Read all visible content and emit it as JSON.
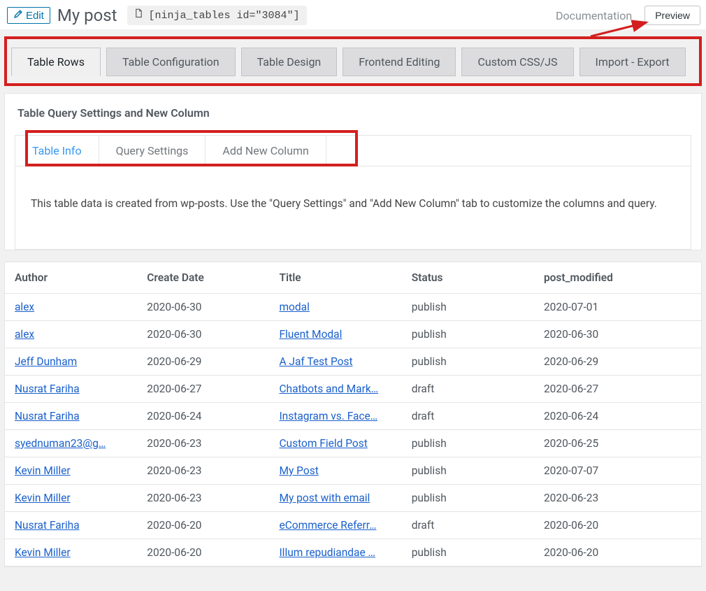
{
  "header": {
    "edit_label": "Edit",
    "title": "My post",
    "shortcode": "[ninja_tables id=\"3084\"]",
    "documentation_label": "Documentation",
    "preview_label": "Preview"
  },
  "main_tabs": [
    {
      "label": "Table Rows",
      "active": true
    },
    {
      "label": "Table Configuration",
      "active": false
    },
    {
      "label": "Table Design",
      "active": false
    },
    {
      "label": "Frontend Editing",
      "active": false
    },
    {
      "label": "Custom CSS/JS",
      "active": false
    },
    {
      "label": "Import - Export",
      "active": false
    }
  ],
  "panel": {
    "title": "Table Query Settings and New Column",
    "sub_tabs": [
      {
        "label": "Table Info",
        "active": true
      },
      {
        "label": "Query Settings",
        "active": false
      },
      {
        "label": "Add New Column",
        "active": false
      }
    ],
    "info_text": "This table data is created from wp-posts. Use the \"Query Settings\" and \"Add New Column\" tab to customize the columns and query."
  },
  "table": {
    "cols": [
      "Author",
      "Create Date",
      "Title",
      "Status",
      "post_modified"
    ],
    "rows": [
      {
        "author": "alex",
        "create_date": "2020-06-30",
        "title": "modal",
        "status": "publish",
        "post_modified": "2020-07-01"
      },
      {
        "author": "alex",
        "create_date": "2020-06-30",
        "title": "Fluent Modal",
        "status": "publish",
        "post_modified": "2020-06-30"
      },
      {
        "author": "Jeff Dunham",
        "create_date": "2020-06-29",
        "title": "A Jaf Test Post",
        "status": "publish",
        "post_modified": "2020-06-29"
      },
      {
        "author": "Nusrat Fariha",
        "create_date": "2020-06-27",
        "title": "Chatbots and Mark…",
        "status": "draft",
        "post_modified": "2020-06-27"
      },
      {
        "author": "Nusrat Fariha",
        "create_date": "2020-06-24",
        "title": "Instagram vs. Face…",
        "status": "draft",
        "post_modified": "2020-06-24"
      },
      {
        "author": "syednuman23@g…",
        "create_date": "2020-06-23",
        "title": "Custom Field Post",
        "status": "publish",
        "post_modified": "2020-06-25"
      },
      {
        "author": "Kevin Miller",
        "create_date": "2020-06-23",
        "title": "My Post",
        "status": "publish",
        "post_modified": "2020-07-07"
      },
      {
        "author": "Kevin Miller",
        "create_date": "2020-06-23",
        "title": "My post with email",
        "status": "publish",
        "post_modified": "2020-06-23"
      },
      {
        "author": "Nusrat Fariha",
        "create_date": "2020-06-20",
        "title": "eCommerce Referr…",
        "status": "draft",
        "post_modified": "2020-06-20"
      },
      {
        "author": "Kevin Miller",
        "create_date": "2020-06-20",
        "title": "Illum repudiandae …",
        "status": "publish",
        "post_modified": "2020-06-20"
      }
    ]
  }
}
